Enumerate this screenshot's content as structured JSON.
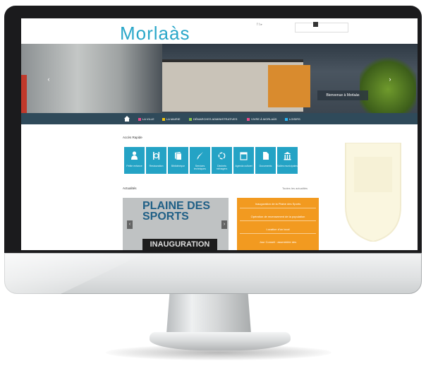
{
  "site": {
    "logo": "Morlaàs",
    "search_placeholder": "",
    "accent_color": "#2aa7c9",
    "nav_color": "#2f4a5a"
  },
  "hero": {
    "caption": "Bienvenue à Morlaàs"
  },
  "nav": {
    "items": [
      {
        "label": "LA VILLE",
        "color": "#e74c8a"
      },
      {
        "label": "LA MAIRIE",
        "color": "#f1c40f"
      },
      {
        "label": "DÉMARCHES ADMINISTRATIVES",
        "color": "#8bc34a"
      },
      {
        "label": "VIVRE À MORLAÀS",
        "color": "#e74c8a"
      },
      {
        "label": "LOISIRS",
        "color": "#29b6f6"
      }
    ]
  },
  "services": {
    "title": "Accès Rapide",
    "tiles": [
      {
        "label": "Petite enfance",
        "icon": "person-icon"
      },
      {
        "label": "Restauration",
        "icon": "cutlery-icon"
      },
      {
        "label": "Bibliothèque",
        "icon": "book-icon"
      },
      {
        "label": "Services techniques",
        "icon": "brush-icon"
      },
      {
        "label": "Déchets ménagers",
        "icon": "recycle-icon"
      },
      {
        "label": "Agenda culturel",
        "icon": "calendar-icon"
      },
      {
        "label": "Documents",
        "icon": "document-icon"
      },
      {
        "label": "Salles municipales",
        "icon": "building-icon"
      }
    ]
  },
  "news": {
    "title": "Actualités",
    "link": "Toutes les actualités",
    "headline_top": "PLAINE DES",
    "headline_main": "SPORTS",
    "headline_bottom": "INAUGURATION",
    "items": [
      "Inauguration de la Plaine des Sports",
      "Opération de recensement de la population",
      "Location d'un local",
      "Jour Conseil : assemblée des"
    ]
  }
}
